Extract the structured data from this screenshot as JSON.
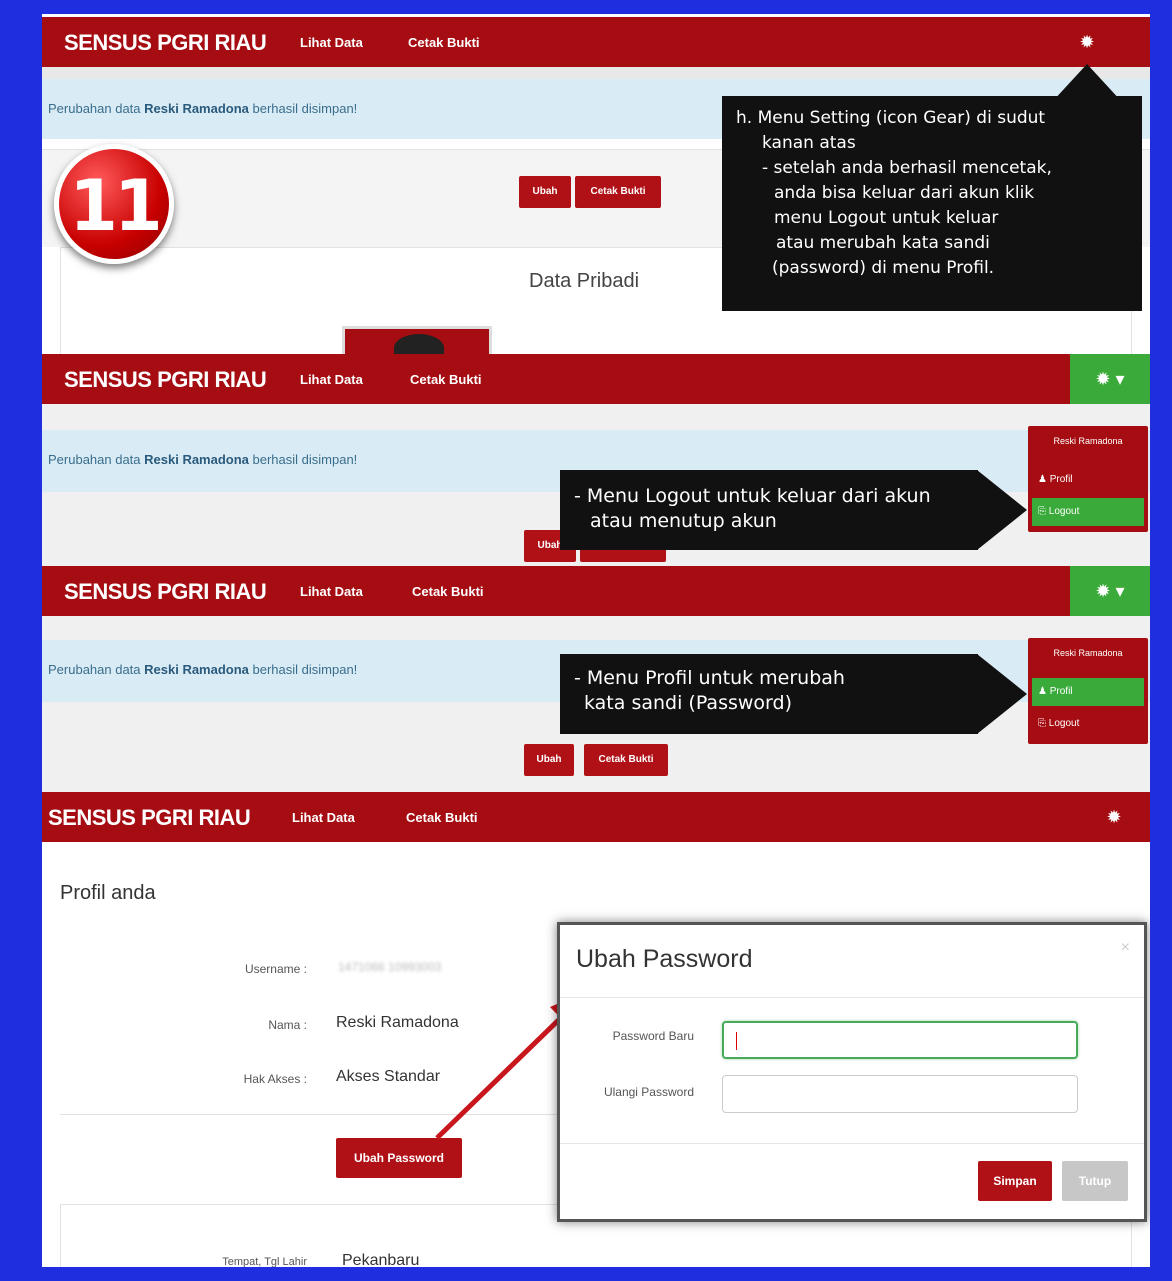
{
  "app": {
    "brand": "SENSUS PGRI RIAU",
    "nav_lihat": "Lihat Data",
    "nav_cetak": "Cetak Bukti"
  },
  "alert": {
    "prefix": "Perubahan data ",
    "name": "Reski Ramadona",
    "suffix": " berhasil disimpan!"
  },
  "badge": "11",
  "panel1": {
    "btn_ubah": "Ubah",
    "btn_cetak": "Cetak Bukti",
    "section_title": "Data Pribadi",
    "callout_lines": [
      "h. Menu Setting (icon Gear) di sudut",
      "kanan atas",
      "- setelah anda berhasil mencetak,",
      "anda bisa keluar dari akun klik",
      "menu Logout untuk keluar",
      "atau merubah kata sandi",
      "(password) di menu Profil."
    ]
  },
  "dropdown": {
    "user": "Reski Ramadona",
    "profil": "Profil",
    "logout": "Logout"
  },
  "panel2": {
    "btn_ubah": "Ubah",
    "callout_lines": [
      "- Menu Logout untuk keluar dari akun",
      "atau menutup akun"
    ]
  },
  "panel3": {
    "btn_ubah": "Ubah",
    "btn_cetak": "Cetak Bukti",
    "callout_lines": [
      "- Menu Profil untuk merubah",
      "kata sandi (Password)"
    ]
  },
  "profile": {
    "title": "Profil anda",
    "username_label": "Username :",
    "username_value": "1471066 10993003",
    "nama_label": "Nama :",
    "nama_value": "Reski Ramadona",
    "hak_label": "Hak Akses :",
    "hak_value": "Akses Standar",
    "ubah_password_btn": "Ubah Password",
    "ttl_label": "Tempat, Tgl Lahir",
    "ttl_value": "Pekanbaru"
  },
  "modal": {
    "title": "Ubah Password",
    "close": "×",
    "new_pw_label": "Password Baru",
    "repeat_pw_label": "Ulangi Password",
    "save": "Simpan",
    "close_btn": "Tutup"
  },
  "colors": {
    "navbar": "#a50d12",
    "accent_green": "#3aab3a",
    "frame_border": "#1f2fe0"
  }
}
